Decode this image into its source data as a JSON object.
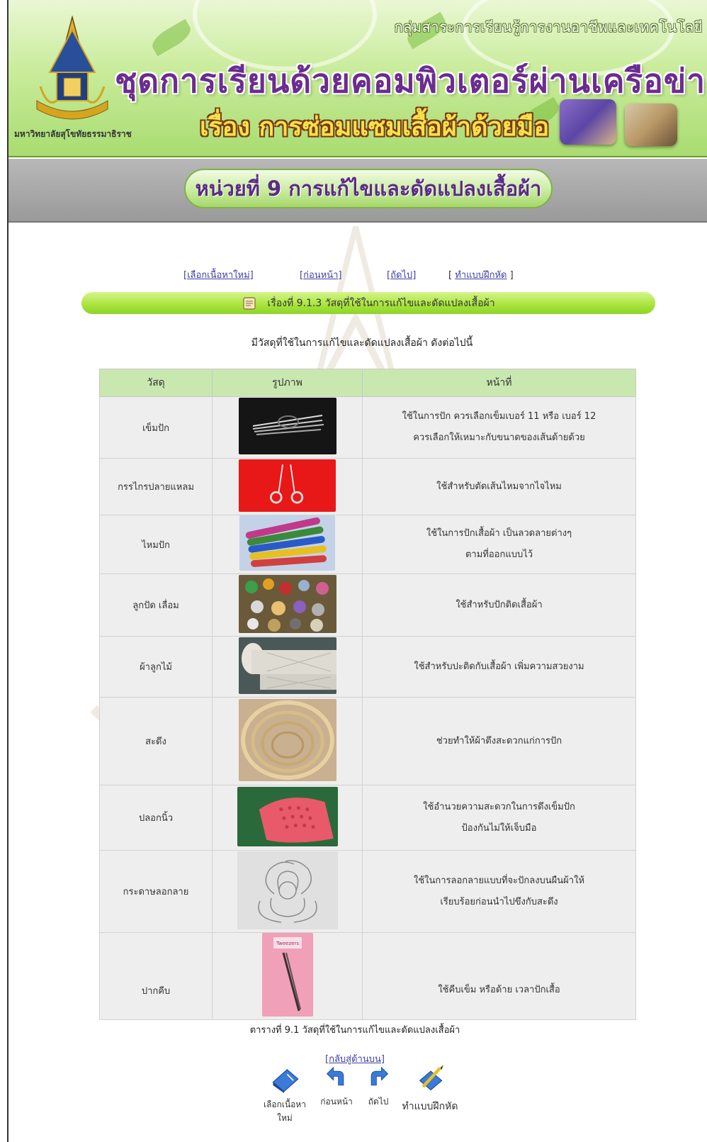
{
  "header": {
    "sub_org": "กลุ่มสาระการเรียนรู้การงานอาชีพและเทคโนโลยี",
    "main_title": "ชุดการเรียนด้วยคอมพิวเตอร์ผ่านเครือข่าย",
    "sub_title": "เรื่อง การซ่อมแซมเสื้อผ้าด้วยมือ",
    "university": "มหาวิทยาลัยสุโขทัยธรรมาธิราช"
  },
  "unit": {
    "title": "หน่วยที่ 9 การแก้ไขและดัดแปลงเสื้อผ้า"
  },
  "nav": {
    "select_new": "เลือกเนื้อหาใหม่",
    "previous": "ก่อนหน้า",
    "next": "ถัดไป",
    "exercise": "ทำแบบฝึกหัด"
  },
  "topic": {
    "title": "เรื่องที่ 9.1.3 วัสดุที่ใช้ในการแก้ไขและดัดแปลงเสื้อผ้า"
  },
  "intro": "มีวัสดุที่ใช้ในการแก้ไขและดัดแปลงเสื้อผ้า ดังต่อไปนี้",
  "table": {
    "headers": [
      "วัสดุ",
      "รูปภาพ",
      "หน้าที่"
    ],
    "rows": [
      {
        "material": "เข็มปัก",
        "desc": [
          "ใช้ในการปัก ควรเลือกเข็มเบอร์ 11 หรือ เบอร์ 12",
          "ควรเลือกให้เหมาะกับขนาดของเส้นด้ายด้วย"
        ]
      },
      {
        "material": "กรรไกรปลายแหลม",
        "desc": [
          "ใช้สำหรับตัดเส้นไหมจากไจไหม"
        ]
      },
      {
        "material": "ไหมปัก",
        "desc": [
          "ใช้ในการปักเสื้อผ้า เป็นลวดลายต่างๆ",
          "ตามที่ออกแบบไว้"
        ]
      },
      {
        "material": "ลูกปัด เลื่อม",
        "desc": [
          "ใช้สำหรับปักติดเสื้อผ้า"
        ]
      },
      {
        "material": "ผ้าลูกไม้",
        "desc": [
          "ใช้สำหรับปะติดกับเสื้อผ้า เพิ่มความสวยงาม"
        ]
      },
      {
        "material": "สะดึง",
        "desc": [
          "ช่วยทำให้ผ้าตึงสะดวกแก่การปัก"
        ]
      },
      {
        "material": "ปลอกนิ้ว",
        "desc": [
          "ใช้อำนวยความสะดวกในการดึงเข็มปัก",
          "ป้องกันไม่ให้เจ็บมือ"
        ]
      },
      {
        "material": "กระดาษลอกลาย",
        "desc": [
          "ใช้ในการลอกลายแบบที่จะปักลงบนผืนผ้าให้",
          "เรียบร้อยก่อนนำไปขึงกับสะดึง"
        ]
      },
      {
        "material": "ปากคีบ",
        "desc": [
          "ใช้คีบเข็ม หรือด้าย เวลาปักเสื้อ"
        ]
      }
    ]
  },
  "caption": "ตารางที่ 9.1 วัสดุที่ใช้ในการแก้ไขและดัดแปลงเสื้อผ้า",
  "back_to_top": "กลับสู่ด้านบน",
  "bottom_nav": {
    "select_new": "เลือกเนื้อหาใหม่",
    "previous": "ก่อนหน้า",
    "next": "ถัดไป",
    "exercise": "ทำแบบฝึกหัด"
  },
  "colors": {
    "banner_green": "#a9dc71",
    "title_purple": "#6b2c8f",
    "subtitle_yellow": "#f7e24a",
    "topic_bar_green": "#a8e33c",
    "table_header": "#c9e8b0",
    "link_blue": "#3b3fa8"
  },
  "icons": [
    "emblem-icon",
    "scroll-icon",
    "book-icon",
    "back-arrow-icon",
    "forward-arrow-icon",
    "pencil-book-icon"
  ]
}
